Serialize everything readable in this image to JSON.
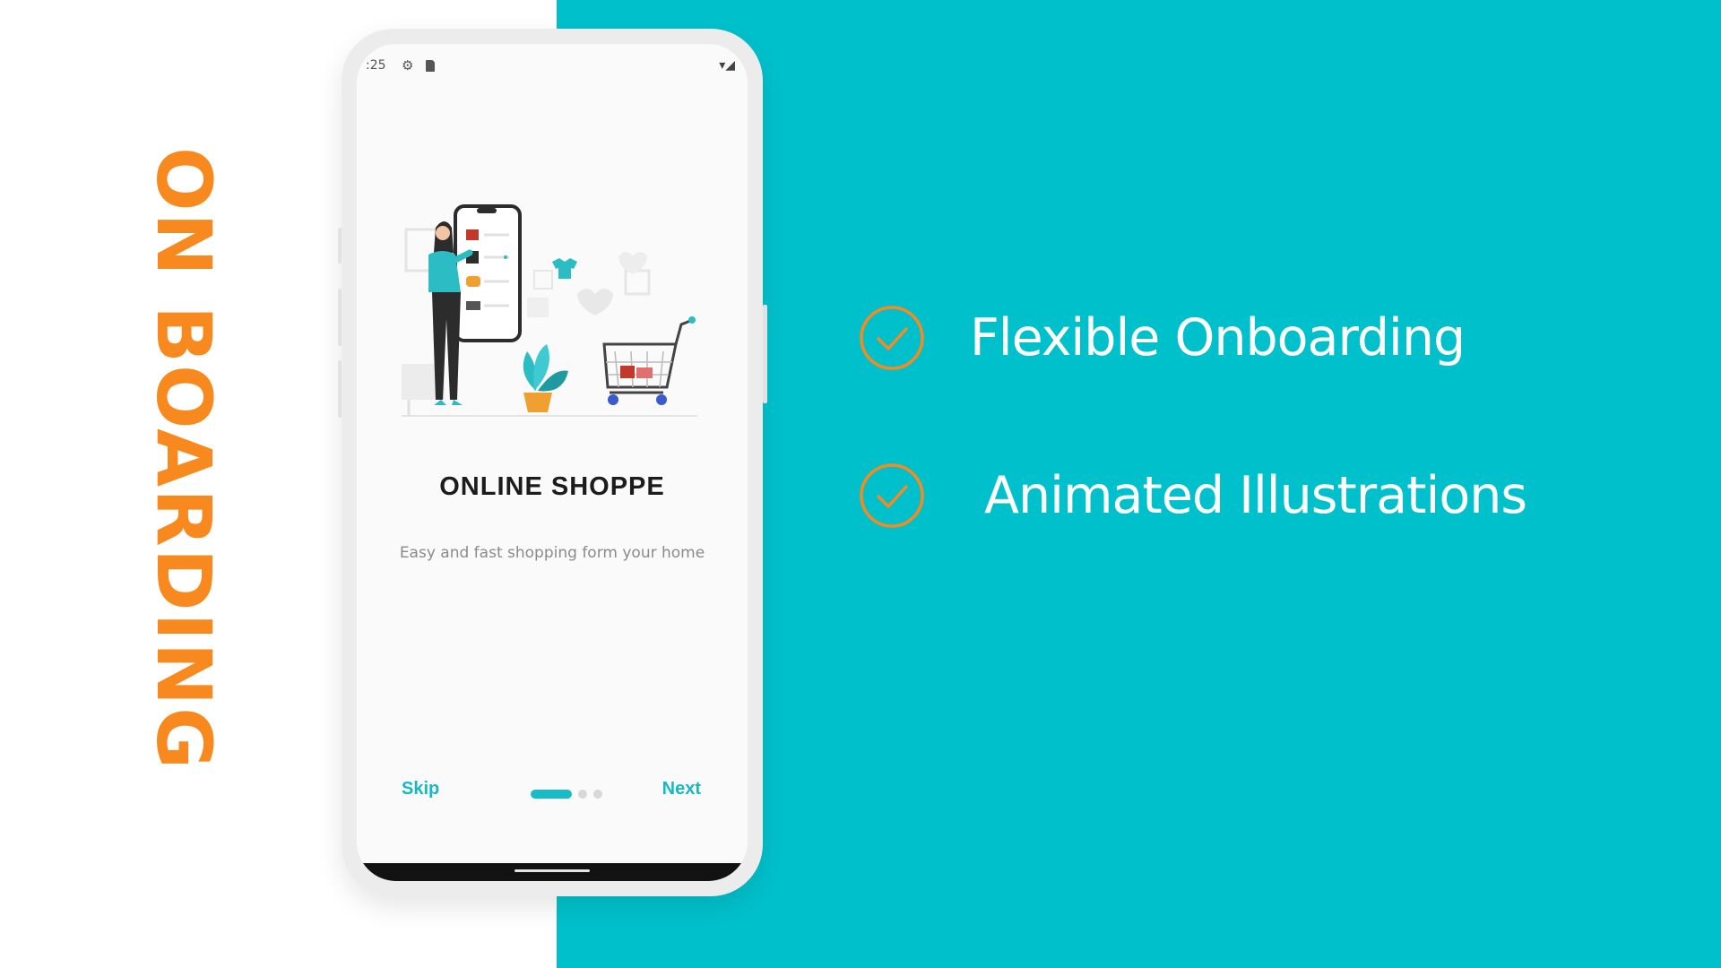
{
  "side_title": "ON BOARDING",
  "phone": {
    "status_bar": {
      "time": ":25",
      "icons": [
        "gear-icon",
        "sd-card-icon",
        "wifi-icon",
        "signal-icon"
      ]
    },
    "illustration": "online-shopping-illustration",
    "title": "ONLINE SHOPPE",
    "subtitle": "Easy and fast shopping form your home",
    "skip_label": "Skip",
    "next_label": "Next",
    "pagination": {
      "total": 3,
      "active": 1
    }
  },
  "features": [
    {
      "icon": "check-circle-icon",
      "label": "Flexible Onboarding"
    },
    {
      "icon": "check-circle-icon",
      "label": "Animated Illustrations"
    }
  ],
  "colors": {
    "teal_background": "#00c1cb",
    "orange_accent": "#f7891f",
    "phone_accent": "#17bcc6",
    "feature_text": "#ffffff"
  }
}
